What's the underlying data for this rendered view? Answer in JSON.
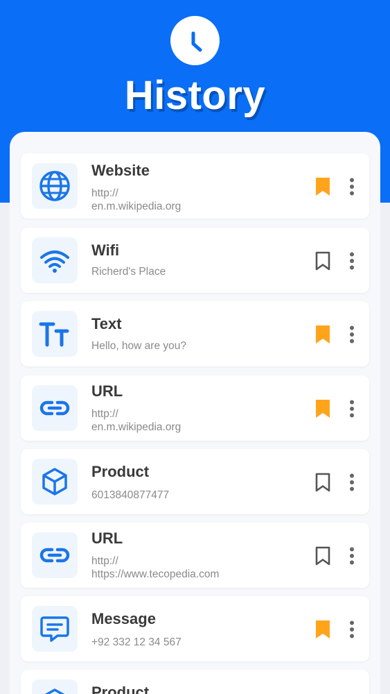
{
  "header": {
    "title": "History",
    "icon": "clock-icon",
    "color": "#0a6ef7"
  },
  "colors": {
    "accent": "#1a76e8",
    "bookmark_active": "#ffa41b",
    "bookmark_inactive": "#555555"
  },
  "items": [
    {
      "type": "website",
      "icon": "globe-icon",
      "title": "Website",
      "subtitle_line1": "http://",
      "subtitle_line2": "en.m.wikipedia.org",
      "bookmarked": true
    },
    {
      "type": "wifi",
      "icon": "wifi-icon",
      "title": "Wifi",
      "subtitle_line1": "Richerd's Place",
      "subtitle_line2": "",
      "bookmarked": false
    },
    {
      "type": "text",
      "icon": "text-size-icon",
      "title": "Text",
      "subtitle_line1": "Hello, how are you?",
      "subtitle_line2": "",
      "bookmarked": true
    },
    {
      "type": "url",
      "icon": "link-icon",
      "title": "URL",
      "subtitle_line1": "http://",
      "subtitle_line2": "en.m.wikipedia.org",
      "bookmarked": true
    },
    {
      "type": "product",
      "icon": "cube-icon",
      "title": "Product",
      "subtitle_line1": "6013840877477",
      "subtitle_line2": "",
      "bookmarked": false
    },
    {
      "type": "url",
      "icon": "link-icon",
      "title": "URL",
      "subtitle_line1": "http://",
      "subtitle_line2": "https://www.tecopedia.com",
      "bookmarked": false
    },
    {
      "type": "message",
      "icon": "message-icon",
      "title": "Message",
      "subtitle_line1": "+92 332 12 34 567",
      "subtitle_line2": "",
      "bookmarked": true
    },
    {
      "type": "product",
      "icon": "cube-icon",
      "title": "Product",
      "subtitle_line1": "",
      "subtitle_line2": "",
      "bookmarked": false
    }
  ]
}
